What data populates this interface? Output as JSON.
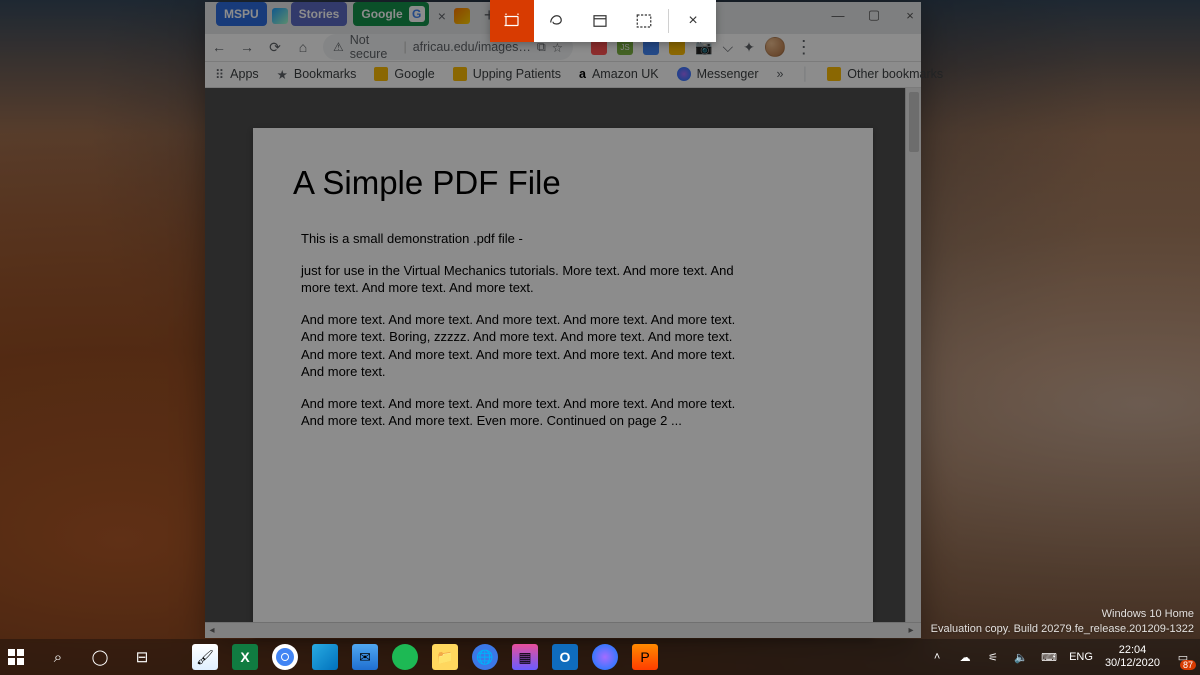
{
  "snip_toolbar": {
    "modes": [
      "rectangular-snip",
      "freeform-snip",
      "window-snip",
      "fullscreen-snip"
    ],
    "active_mode": "rectangular-snip",
    "close_label": "×"
  },
  "browser": {
    "tabs": {
      "mspu": "MSPU",
      "stories": "Stories",
      "google": "Google",
      "g_letter": "G",
      "close_x": "×",
      "newtab": "+"
    },
    "window_controls": {
      "min": "—",
      "max": "▢",
      "close": "×"
    },
    "address": {
      "not_secure": "Not secure",
      "url": "africau.edu/images…",
      "star": "☆"
    },
    "extensions_row": {
      "bolt": "⚡",
      "js": "JS",
      "blue": "■",
      "orange": "■",
      "camera": "📷",
      "save": "⌵",
      "puzzle": "✦",
      "menu": "⋮"
    },
    "bookmarks": {
      "apps": "Apps",
      "bookmarks": "Bookmarks",
      "google": "Google",
      "upping": "Upping Patients",
      "amazon": "Amazon UK",
      "messenger": "Messenger",
      "chevron": "»",
      "other": "Other bookmarks"
    },
    "pdf": {
      "title": "A Simple PDF File",
      "p1": "This is a small demonstration .pdf file -",
      "p2": "just for use in the Virtual Mechanics tutorials. More text. And more text. And more text. And more text. And more text.",
      "p3": "And more text. And more text. And more text. And more text. And more text. And more text. Boring, zzzzz. And more text. And more text. And more text. And more text. And more text. And more text. And more text. And more text. And more text.",
      "p4": "And more text. And more text. And more text. And more text. And more text. And more text. And more text. Even more. Continued on page 2 ..."
    }
  },
  "watermark": {
    "line1": "Windows 10 Home",
    "line2": "Evaluation copy. Build 20279.fe_release.201209-1322"
  },
  "taskbar": {
    "tray": {
      "lang": "ENG"
    },
    "clock": {
      "time": "22:04",
      "date": "30/12/2020"
    },
    "notif_count": "87"
  }
}
